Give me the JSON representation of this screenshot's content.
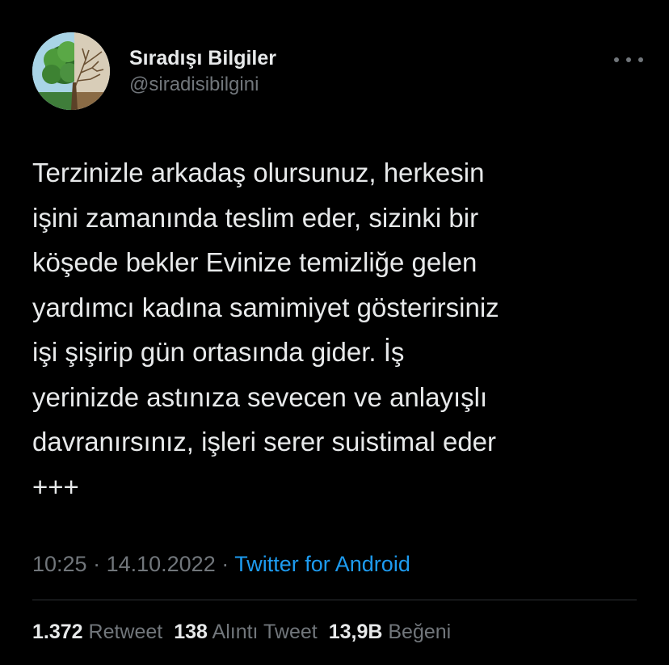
{
  "author": {
    "display_name": "Sıradışı Bilgiler",
    "handle": "@siradisibilgini",
    "avatar_icon": "tree-half-green-half-dry-avatar"
  },
  "more_menu_icon": "more-horizontal-icon",
  "tweet": {
    "lines": [
      "Terzinizle arkadaş olursunuz, herkesin",
      "işini zamanında teslim eder, sizinki bir",
      "köşede bekler Evinize temizliğe gelen",
      "yardımcı kadına samimiyet gösterirsiniz",
      "işi şişirip gün ortasında gider. İş",
      "yerinizde astınıza sevecen ve anlayışlı",
      "davranırsınız, işleri serer suistimal eder",
      "+++"
    ]
  },
  "meta": {
    "time": "10:25",
    "separator_1": " · ",
    "date": "14.10.2022",
    "separator_2": " · ",
    "source": "Twitter for Android"
  },
  "stats": {
    "retweets_count": "1.372",
    "retweets_label": "Retweet",
    "quotes_count": "138",
    "quotes_label": "Alıntı Tweet",
    "likes_count": "13,9B",
    "likes_label": "Beğeni"
  },
  "colors": {
    "background": "#000000",
    "primary_text": "#e7e9ea",
    "secondary_text": "#71767b",
    "link": "#1d9bf0",
    "divider": "#2f3336"
  }
}
